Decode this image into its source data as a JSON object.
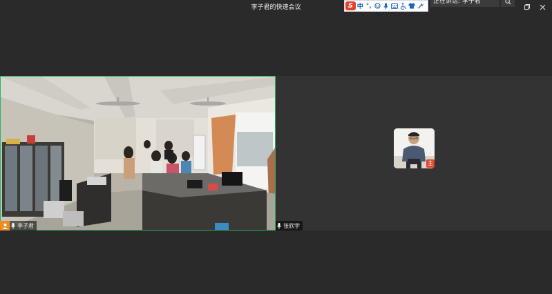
{
  "window": {
    "title": "李子君的快速会议"
  },
  "ime": {
    "mode_label": "中",
    "punct_label": "°,"
  },
  "speaker": {
    "text": "正在讲话: 李子君"
  },
  "participants": [
    {
      "name": "李子君",
      "role": "host",
      "mic": "on"
    },
    {
      "name": "张欣宇",
      "mic": "on"
    }
  ],
  "avatar": {
    "badge_label": "主"
  },
  "colors": {
    "background": "#2a2a2a",
    "active_speaker_border": "#28b463",
    "host_badge": "#f08c1e",
    "ime_logo": "#e8412c"
  }
}
